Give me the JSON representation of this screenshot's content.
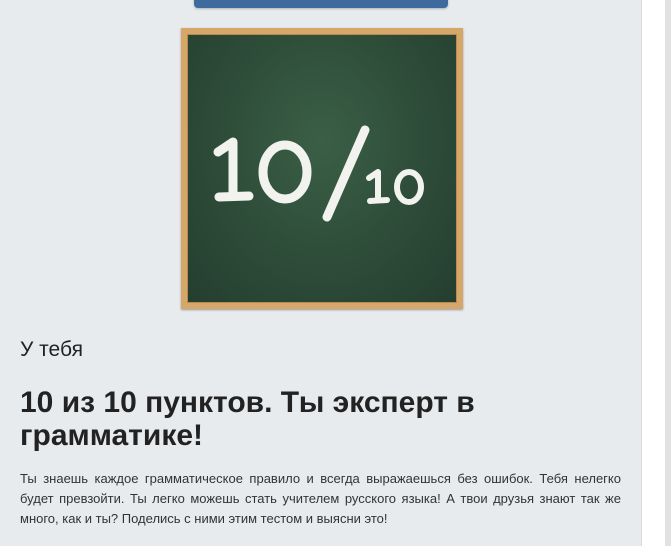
{
  "result": {
    "board_text": "10/10",
    "label": "У тебя",
    "title": "10 из 10 пунктов. Ты эксперт в грамматике!",
    "description": "Ты знаешь каждое грамматическое правило и всегда выражаешься без ошибок. Тебя нелегко будет превзойти. Ты легко можешь стать учителем русского языка! А твои друзья знают так же много, как и ты? Поделись с ними этим тестом и выясни это!"
  },
  "colors": {
    "panel_background": "#e8ebee",
    "button_blue": "#3f6a9e",
    "chalkboard_green": "#2c4a37",
    "board_frame": "#d5a86a"
  }
}
